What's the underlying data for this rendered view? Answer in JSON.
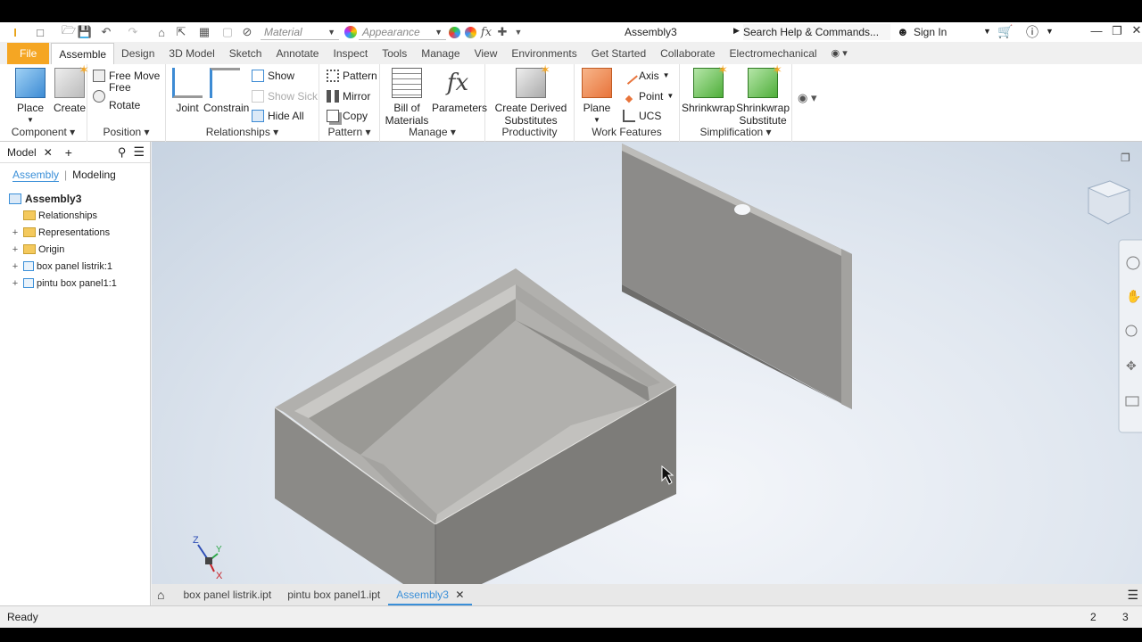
{
  "titlebar": {
    "material_placeholder": "Material",
    "appearance_placeholder": "Appearance",
    "doc_title": "Assembly3",
    "search": "Search Help & Commands...",
    "sign_in": "Sign In"
  },
  "tabs": [
    "File",
    "Assemble",
    "Design",
    "3D Model",
    "Sketch",
    "Annotate",
    "Inspect",
    "Tools",
    "Manage",
    "View",
    "Environments",
    "Get Started",
    "Collaborate",
    "Electromechanical"
  ],
  "ribbon": {
    "component": {
      "place": "Place",
      "create": "Create",
      "title": "Component"
    },
    "position": {
      "free_move": "Free Move",
      "free_rotate": "Free Rotate",
      "title": "Position"
    },
    "relationships": {
      "joint": "Joint",
      "constrain": "Constrain",
      "show": "Show",
      "show_sick": "Show Sick",
      "hide_all": "Hide All",
      "title": "Relationships"
    },
    "pattern": {
      "pattern": "Pattern",
      "mirror": "Mirror",
      "copy": "Copy",
      "title": "Pattern"
    },
    "manage": {
      "bom_line1": "Bill of",
      "bom_line2": "Materials",
      "parameters": "Parameters",
      "title": "Manage"
    },
    "productivity": {
      "line1": "Create Derived",
      "line2": "Substitutes",
      "title": "Productivity"
    },
    "work_features": {
      "plane": "Plane",
      "axis": "Axis",
      "point": "Point",
      "ucs": "UCS",
      "title": "Work Features"
    },
    "simplification": {
      "shrinkwrap": "Shrinkwrap",
      "shrink_sub1": "Shrinkwrap",
      "shrink_sub2": "Substitute",
      "title": "Simplification"
    }
  },
  "browser": {
    "tab_model": "Model",
    "sub_assembly": "Assembly",
    "sub_modeling": "Modeling",
    "tree": {
      "root": "Assembly3",
      "relationships": "Relationships",
      "representations": "Representations",
      "origin": "Origin",
      "part1": "box panel listrik:1",
      "part2": "pintu box panel1:1"
    }
  },
  "axes": {
    "z": "Z",
    "y": "Y",
    "x": "X"
  },
  "doctabs": [
    "box panel listrik.ipt",
    "pintu box panel1.ipt",
    "Assembly3"
  ],
  "status": {
    "text": "Ready",
    "n1": "2",
    "n2": "3"
  },
  "colors": {
    "accent": "#f5a623",
    "link": "#3a8fd8"
  }
}
